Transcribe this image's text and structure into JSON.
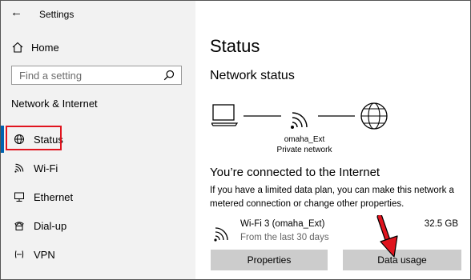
{
  "window": {
    "title": "Settings",
    "back_glyph": "←"
  },
  "sidebar": {
    "home_label": "Home",
    "search_placeholder": "Find a setting",
    "section_title": "Network & Internet",
    "items": [
      {
        "label": "Status",
        "icon": "status-globe-icon",
        "selected": true
      },
      {
        "label": "Wi-Fi",
        "icon": "wifi-icon"
      },
      {
        "label": "Ethernet",
        "icon": "ethernet-icon"
      },
      {
        "label": "Dial-up",
        "icon": "dialup-icon"
      },
      {
        "label": "VPN",
        "icon": "vpn-icon"
      }
    ]
  },
  "main": {
    "title": "Status",
    "subtitle": "Network status",
    "network": {
      "name": "omaha_Ext",
      "type": "Private network"
    },
    "connected_heading": "You’re connected to the Internet",
    "description": "If you have a limited data plan, you can make this network a metered connection or change other properties.",
    "connection": {
      "name": "Wi-Fi 3 (omaha_Ext)",
      "period": "From the last 30 days",
      "usage": "32.5 GB"
    },
    "buttons": {
      "properties": "Properties",
      "data_usage": "Data usage"
    }
  },
  "colors": {
    "accent": "#0063b1",
    "highlight": "#e0141e",
    "sidebar_bg": "#f2f2f2",
    "button_bg": "#cccccc"
  }
}
